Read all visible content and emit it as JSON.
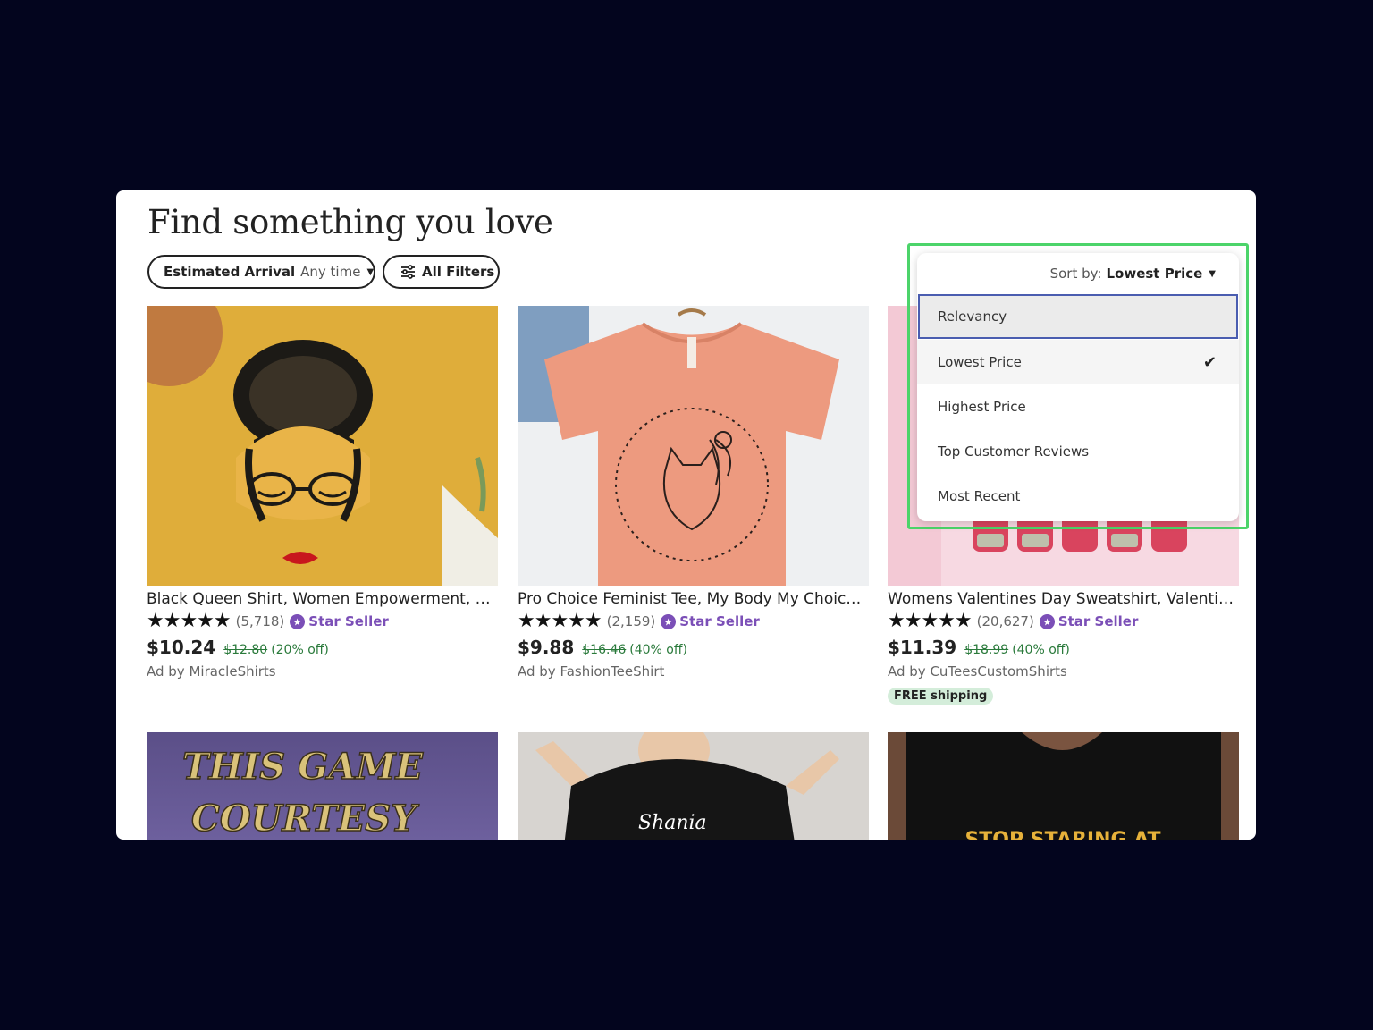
{
  "heading": "Find something you love",
  "filters": {
    "arrival_label": "Estimated Arrival",
    "arrival_value": "Any time",
    "all_filters": "All Filters"
  },
  "sort": {
    "label": "Sort by:",
    "value": "Lowest Price",
    "options": [
      "Relevancy",
      "Lowest Price",
      "Highest Price",
      "Top Customer Reviews",
      "Most Recent"
    ],
    "selected": "Lowest Price",
    "hovered": "Relevancy"
  },
  "products": [
    {
      "name": "Black Queen Shirt, Women Empowerment, Bla...",
      "stars": "★★★★★",
      "reviews": "(5,718)",
      "badge": "Star Seller",
      "price": "$10.24",
      "original_price": "$12.80",
      "discount": "(20% off)",
      "seller": "Ad by MiracleShirts",
      "shipping": ""
    },
    {
      "name": "Pro Choice Feminist Tee, My Body My Choice S...",
      "stars": "★★★★★",
      "reviews": "(2,159)",
      "badge": "Star Seller",
      "price": "$9.88",
      "original_price": "$16.46",
      "discount": "(40% off)",
      "seller": "Ad by FashionTeeShirt",
      "shipping": ""
    },
    {
      "name": "Womens Valentines Day Sweatshirt, Valentine ...",
      "stars": "★★★★★",
      "reviews": "(20,627)",
      "badge": "Star Seller",
      "price": "$11.39",
      "original_price": "$18.99",
      "discount": "(40% off)",
      "seller": "Ad by CuTeesCustomShirts",
      "shipping": "FREE shipping"
    }
  ],
  "row2_images": {
    "game_text": [
      "THIS GAME",
      "COURTESY"
    ],
    "shania_text": "Shania",
    "stop_text": "STOP STARING AT"
  },
  "colors": {
    "page_background": "#03051e",
    "focus_ring": "#4cd46a",
    "hover_outline": "#4a5db0",
    "star_seller": "#7b4fb7",
    "discount_green": "#2a7a3b"
  }
}
